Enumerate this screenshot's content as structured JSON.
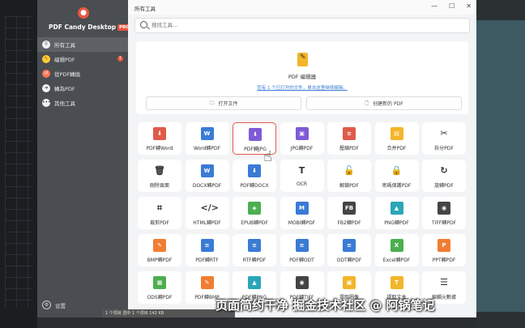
{
  "sidebar": {
    "app_name": "PDF Candy Desktop",
    "pro_badge": "PRO",
    "items": [
      {
        "label": "所有工具",
        "icon": "grid-icon",
        "glyph": "⠿"
      },
      {
        "label": "编辑PDF",
        "icon": "edit-icon",
        "glyph": "✎",
        "badge": "1"
      },
      {
        "label": "從PDF轉換",
        "icon": "convert-from-icon",
        "glyph": "↺"
      },
      {
        "label": "轉為PDF",
        "icon": "convert-to-icon",
        "glyph": "➜"
      },
      {
        "label": "其他工具",
        "icon": "more-icon",
        "glyph": "•••"
      }
    ],
    "settings_label": "设置"
  },
  "titlebar": {
    "title": "所有工具",
    "minimize": "—",
    "maximize": "☐",
    "close": "✕"
  },
  "search": {
    "placeholder": "搜找工具..."
  },
  "editor": {
    "title": "PDF 编辑器",
    "recent_link": "您有 1 个已打开的文件，单击这里继续编辑。",
    "open_file": "打开文件",
    "create_new": "创建新的 PDF"
  },
  "tools": [
    [
      "PDF轉Word",
      "Word轉PDF",
      "PDF轉JPG",
      "JPG轉PDF",
      "壓縮PDF",
      "合并PDF",
      "拆分PDF"
    ],
    [
      "刪除頁面",
      "DOCX轉PDF",
      "PDF轉DOCX",
      "OCR",
      "解鎖PDF",
      "密碼保護PDF",
      "旋轉PDF"
    ],
    [
      "裁剪PDF",
      "HTML轉PDF",
      "EPUB轉PDF",
      "MOBI轉PDF",
      "FB2轉PDF",
      "PNG轉PDF",
      "TIFF轉PDF"
    ],
    [
      "BMP轉PDF",
      "PDF轉RTF",
      "RTF轉PDF",
      "PDF轉ODT",
      "ODT轉PDF",
      "Excel轉PDF",
      "PPT轉PDF"
    ],
    [
      "ODS轉PDF",
      "PDF轉BMP",
      "PDF轉PNG",
      "PDF轉TIFF",
      "提取圖像",
      "提取文本",
      "編輯元數據"
    ]
  ],
  "tool_icons": [
    [
      {
        "n": "pdf-to-word-icon",
        "c": "red",
        "g": "⬇"
      },
      {
        "n": "word-icon",
        "c": "blue",
        "g": "W"
      },
      {
        "n": "pdf-to-jpg-icon",
        "c": "purple",
        "g": "⬇"
      },
      {
        "n": "jpg-icon",
        "c": "purple",
        "g": "▣"
      },
      {
        "n": "compress-icon",
        "c": "red",
        "g": "≡"
      },
      {
        "n": "merge-icon",
        "c": "yellow",
        "g": "▤"
      },
      {
        "n": "scissors-icon",
        "c": "outline",
        "g": "✂"
      }
    ],
    [
      {
        "n": "trash-icon",
        "c": "outline",
        "g": "🗑"
      },
      {
        "n": "docx-icon",
        "c": "blue",
        "g": "W"
      },
      {
        "n": "pdf-to-docx-icon",
        "c": "blue",
        "g": "⬇"
      },
      {
        "n": "ocr-icon",
        "c": "outline",
        "g": "T"
      },
      {
        "n": "unlock-icon",
        "c": "outline",
        "g": "🔓"
      },
      {
        "n": "lock-icon",
        "c": "outline",
        "g": "🔒"
      },
      {
        "n": "rotate-icon",
        "c": "outline",
        "g": "↻"
      }
    ],
    [
      {
        "n": "crop-icon",
        "c": "outline",
        "g": "⌗"
      },
      {
        "n": "html-icon",
        "c": "outline",
        "g": "</>"
      },
      {
        "n": "epub-icon",
        "c": "green",
        "g": "◈"
      },
      {
        "n": "mobi-icon",
        "c": "blue",
        "g": "M"
      },
      {
        "n": "fb2-icon",
        "c": "dark",
        "g": "FB"
      },
      {
        "n": "png-icon",
        "c": "teal",
        "g": "▲"
      },
      {
        "n": "camera-icon",
        "c": "dark",
        "g": "◉"
      }
    ],
    [
      {
        "n": "brush-icon",
        "c": "orange",
        "g": "✎"
      },
      {
        "n": "pdf-to-rtf-icon",
        "c": "blue",
        "g": "≡"
      },
      {
        "n": "rtf-icon",
        "c": "blue",
        "g": "≡"
      },
      {
        "n": "pdf-to-odt-icon",
        "c": "blue",
        "g": "≡"
      },
      {
        "n": "odt-icon",
        "c": "blue",
        "g": "≡"
      },
      {
        "n": "excel-icon",
        "c": "green",
        "g": "X"
      },
      {
        "n": "ppt-icon",
        "c": "orange",
        "g": "P"
      }
    ],
    [
      {
        "n": "ods-icon",
        "c": "green",
        "g": "▦"
      },
      {
        "n": "pdf-to-bmp-icon",
        "c": "orange",
        "g": "✎"
      },
      {
        "n": "pdf-to-png-icon",
        "c": "teal",
        "g": "▲"
      },
      {
        "n": "pdf-to-tiff-icon",
        "c": "dark",
        "g": "◉"
      },
      {
        "n": "extract-images-icon",
        "c": "yellow",
        "g": "▣"
      },
      {
        "n": "extract-text-icon",
        "c": "yellow",
        "g": "T"
      },
      {
        "n": "metadata-icon",
        "c": "outline",
        "g": "☰"
      }
    ]
  ],
  "highlighted_tool": "PDF轉JPG",
  "statusbar": {
    "text": "1 个项目    选中 1 个项目 142 KB"
  },
  "watermark": "页面简约干净 掘金技术社区 @ 阿锅笔记"
}
